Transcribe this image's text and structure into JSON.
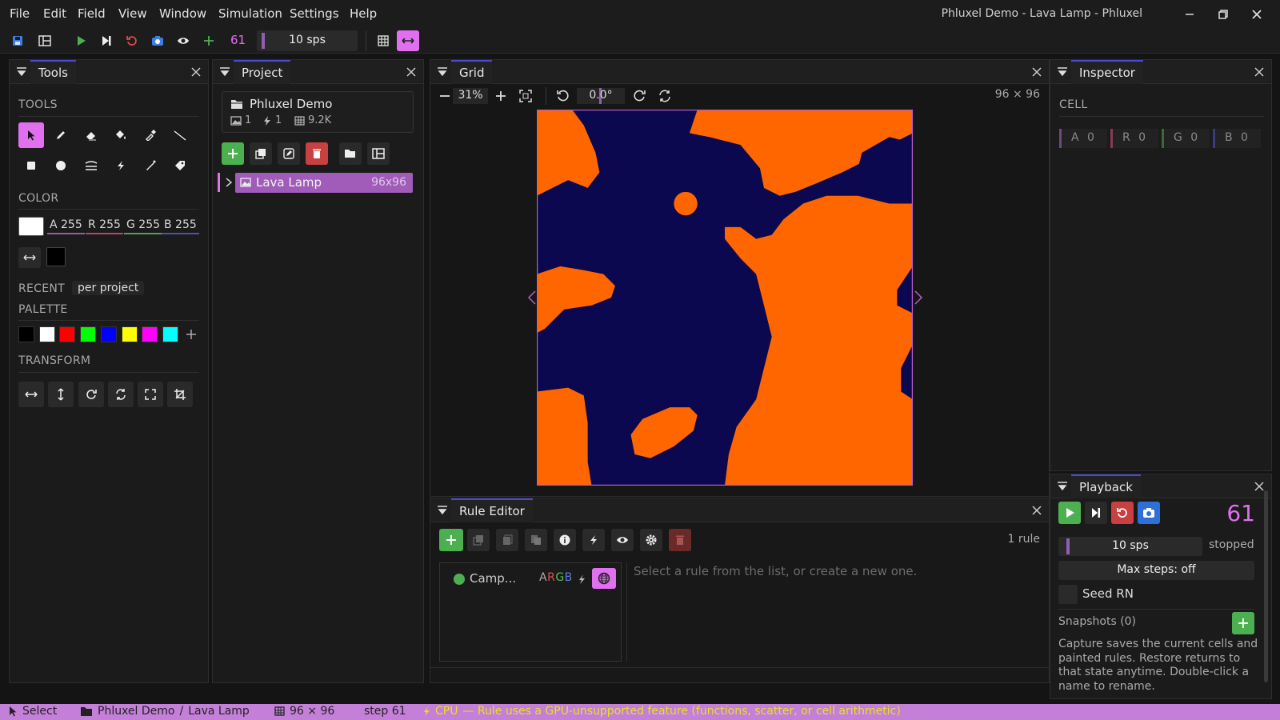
{
  "menubar": {
    "items": [
      "File",
      "Edit",
      "Field",
      "View",
      "Window",
      "Simulation",
      "Settings",
      "Help"
    ],
    "title": "Phluxel Demo - Lava Lamp - Phluxel"
  },
  "toolbar": {
    "step_count": "61",
    "speed": "10 sps"
  },
  "tools_panel": {
    "tab": "Tools",
    "tools_header": "TOOLS",
    "color_header": "COLOR",
    "color": {
      "a": "A 255",
      "r": "R 255",
      "g": "G 255",
      "b": "B 255"
    },
    "recent_label": "RECENT",
    "recent_value": "per project",
    "palette_header": "PALETTE",
    "palette": [
      "#000000",
      "#ffffff",
      "#ff0000",
      "#00ff00",
      "#0000ff",
      "#ffff00",
      "#ff00ff",
      "#00ffff"
    ],
    "transform_header": "TRANSFORM"
  },
  "project_panel": {
    "tab": "Project",
    "project_name": "Phluxel Demo",
    "fields_count": "1",
    "rules_count": "1",
    "cells_count": "9.2K",
    "tree_item": "Lava Lamp",
    "tree_item_size": "96x96"
  },
  "grid_panel": {
    "tab": "Grid",
    "zoom": "31%",
    "rotation": "0.0°",
    "dims": "96 × 96",
    "colors": {
      "fg": "#ff6600",
      "bg": "#0c0850"
    }
  },
  "inspector_panel": {
    "tab": "Inspector",
    "header": "CELL",
    "a": "A 0",
    "r": "R 0",
    "g": "G 0",
    "b": "B 0"
  },
  "rule_editor": {
    "tab": "Rule Editor",
    "rule_count": "1 rule",
    "rule_name": "Camp...",
    "rule_channels": "ARGB",
    "placeholder": "Select a rule from the list, or create a new one."
  },
  "playback_panel": {
    "tab": "Playback",
    "step": "61",
    "speed": "10 sps",
    "state": "stopped",
    "max_steps": "Max steps: off",
    "seed": "Seed RN",
    "snapshots": "Snapshots (0)",
    "help": "Capture saves the current cells and painted rules. Restore returns to that state anytime. Double-click a name to rename."
  },
  "statusbar": {
    "tool": "Select",
    "project": "Phluxel Demo",
    "sep": "/",
    "field": "Lava Lamp",
    "dims": "96 × 96",
    "step": "step 61",
    "backend": "CPU",
    "message": "— Rule uses a GPU-unsupported feature (functions, scatter, or cell arithmetic)"
  },
  "accent_colors": {
    "pink": "#e070f0",
    "green": "#4caf50",
    "red": "#c84040",
    "blue": "#2e6fd8"
  }
}
